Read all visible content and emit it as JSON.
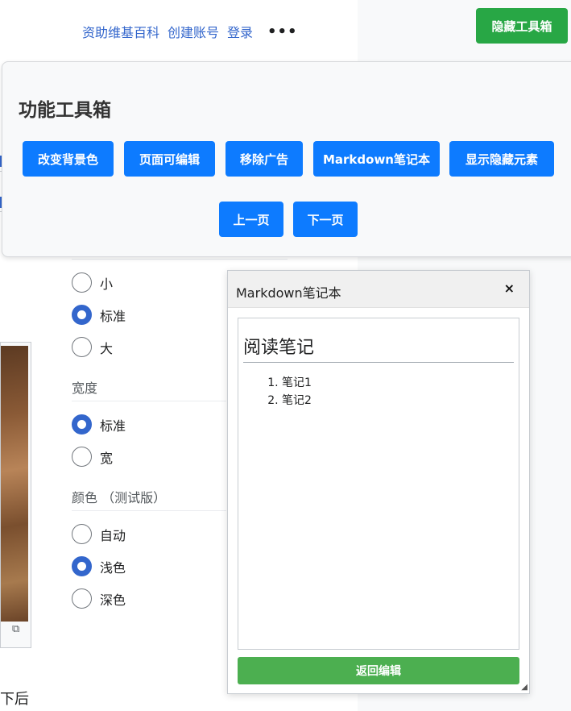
{
  "userlinks": {
    "donate": "资助维基百科",
    "create_account": "创建账号",
    "login": "登录",
    "more": "•••"
  },
  "hide_toolbox_label": "隐藏工具箱",
  "toolbox": {
    "title": "功能工具箱",
    "buttons": {
      "change_bg": "改变背景色",
      "editable": "页面可编辑",
      "remove_ads": "移除广告",
      "markdown": "Markdown笔记本",
      "show_hidden": "显示隐藏元素",
      "prev_page": "上一页",
      "next_page": "下一页"
    }
  },
  "settings": {
    "text_size_options": [
      "小",
      "标准",
      "大"
    ],
    "width_title": "宽度",
    "width_options": [
      "标准",
      "宽"
    ],
    "color_title": "颜色 （测试版）",
    "color_options": [
      "自动",
      "浅色",
      "深色"
    ]
  },
  "article": {
    "bottom_text": "下后"
  },
  "markdown_notebook": {
    "title": "Markdown笔记本",
    "close": "×",
    "heading": "阅读笔记",
    "items": [
      "笔记1",
      "笔记2"
    ],
    "return_label": "返回编辑"
  }
}
